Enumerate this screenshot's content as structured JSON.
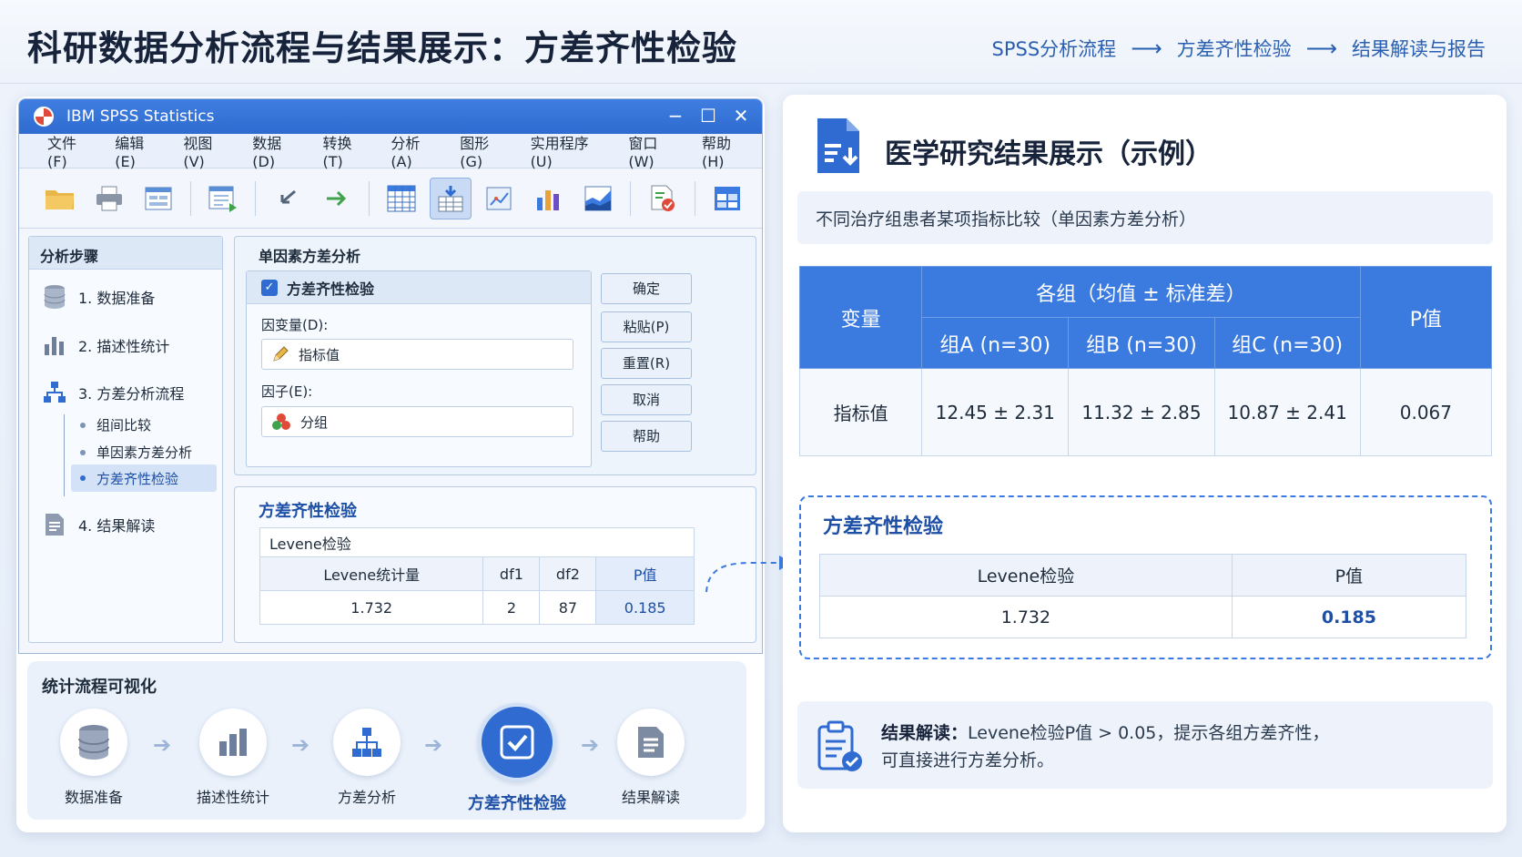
{
  "header": {
    "title": "科研数据分析流程与结果展示：方差齐性检验",
    "breadcrumb": [
      "SPSS分析流程",
      "方差齐性检验",
      "结果解读与报告"
    ]
  },
  "spss": {
    "window_title": "IBM SPSS Statistics",
    "menu": [
      "文件(F)",
      "编辑(E)",
      "视图(V)",
      "数据(D)",
      "转换(T)",
      "分析(A)",
      "图形(G)",
      "实用程序(U)",
      "窗口(W)",
      "帮助(H)"
    ],
    "steps": {
      "heading": "分析步骤",
      "items": [
        "1.  数据准备",
        "2.  描述性统计",
        "3.  方差分析流程",
        "4.  结果解读"
      ],
      "substeps": [
        "组间比较",
        "单因素方差分析",
        "方差齐性检验"
      ]
    },
    "dialog": {
      "heading": "单因素方差分析",
      "checkbox_label": "方差齐性检验",
      "dependent_label": "因变量(D):",
      "dependent_value": "指标值",
      "factor_label": "因子(E):",
      "factor_value": "分组",
      "buttons": [
        "确定",
        "粘贴(P)",
        "重置(R)",
        "取消",
        "帮助"
      ]
    },
    "output": {
      "title": "方差齐性检验",
      "caption": "Levene检验",
      "headers": [
        "Levene统计量",
        "df1",
        "df2",
        "P值"
      ],
      "row": [
        "1.732",
        "2",
        "87",
        "0.185"
      ]
    }
  },
  "flow": {
    "title": "统计流程可视化",
    "nodes": [
      "数据准备",
      "描述性统计",
      "方差分析",
      "方差齐性检验",
      "结果解读"
    ],
    "active_index": 3
  },
  "results": {
    "title": "医学研究结果展示（示例）",
    "subtitle": "不同治疗组患者某项指标比较（单因素方差分析）",
    "table": {
      "col_variable": "变量",
      "col_groups": "各组（均值 ± 标准差）",
      "groups": [
        "组A (n=30)",
        "组B (n=30)",
        "组C (n=30)"
      ],
      "col_p": "P值",
      "row_label": "指标值",
      "values": [
        "12.45 ± 2.31",
        "11.32 ± 2.85",
        "10.87 ± 2.41"
      ],
      "p": "0.067"
    },
    "levene": {
      "title": "方差齐性检验",
      "headers": [
        "Levene检验",
        "P值"
      ],
      "row": [
        "1.732",
        "0.185"
      ]
    },
    "interpretation": {
      "label": "结果解读：",
      "line1": "Levene检验P值 > 0.05，提示各组方差齐性，",
      "line2": "可直接进行方差分析。"
    }
  },
  "colors": {
    "accent": "#2f6bd0",
    "table_header": "#3b7be0",
    "dashed": "#3b7be0"
  }
}
